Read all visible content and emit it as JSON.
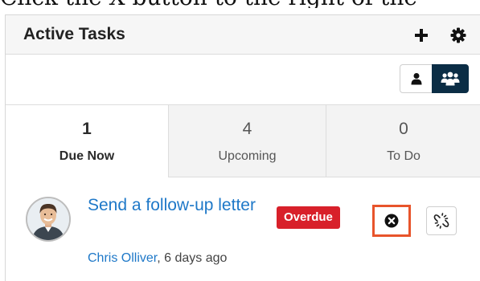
{
  "instruction_text": "Click the X button to the right of the",
  "dashlet": {
    "title": "Active Tasks",
    "add_icon": "plus-icon",
    "settings_icon": "gear-icon"
  },
  "toolbar": {
    "my_items_icon": "user-icon",
    "team_icon": "users-icon",
    "active_filter": "team"
  },
  "tabs": [
    {
      "count": "1",
      "label": "Due Now",
      "active": true
    },
    {
      "count": "4",
      "label": "Upcoming",
      "active": false
    },
    {
      "count": "0",
      "label": "To Do",
      "active": false
    }
  ],
  "task": {
    "title": "Send a follow-up letter",
    "badge": "Overdue",
    "assigned_user": "Chris Olliver",
    "time_ago": ", 6 days ago",
    "close_icon": "close-circle-icon",
    "unlink_icon": "unlink-icon"
  },
  "colors": {
    "link": "#1e78c8",
    "badge": "#d8202a",
    "highlight": "#e8542b",
    "active_segment": "#0b2d45"
  }
}
